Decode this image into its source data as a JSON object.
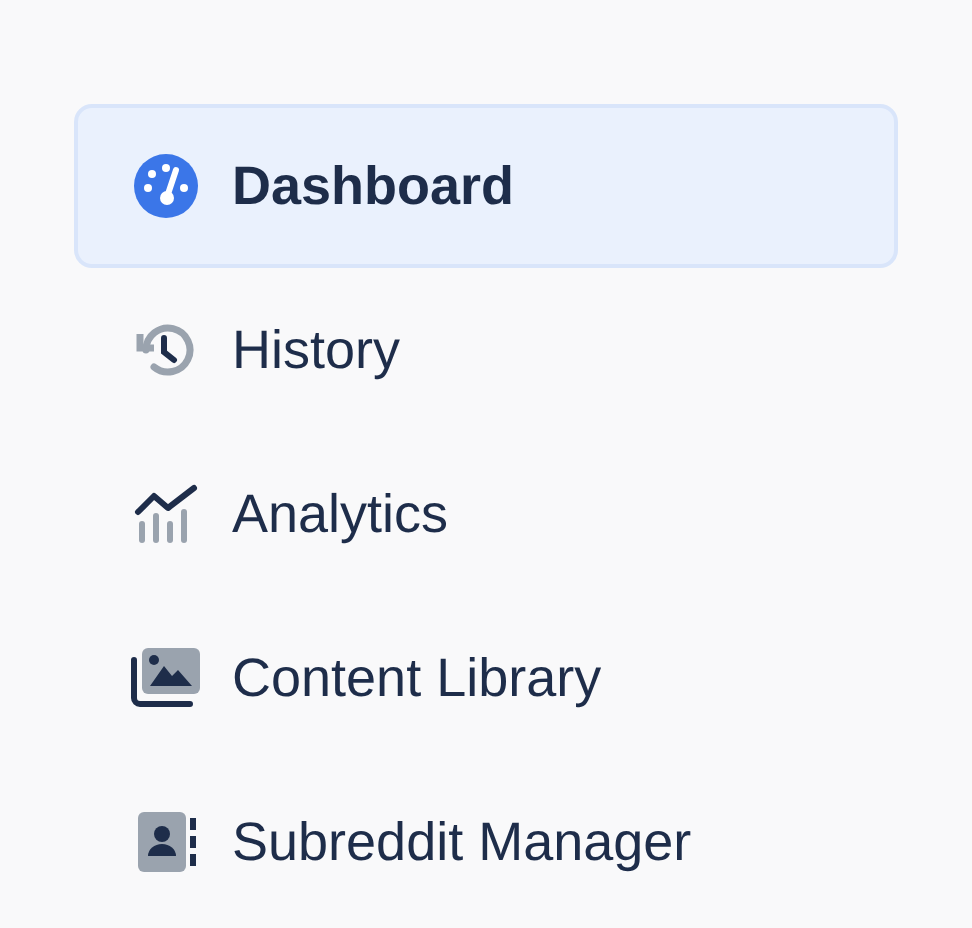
{
  "nav": [
    {
      "label": "Dashboard",
      "selected": true
    },
    {
      "label": "History",
      "selected": false
    },
    {
      "label": "Analytics",
      "selected": false
    },
    {
      "label": "Content Library",
      "selected": false
    },
    {
      "label": "Subreddit Manager",
      "selected": false
    }
  ]
}
